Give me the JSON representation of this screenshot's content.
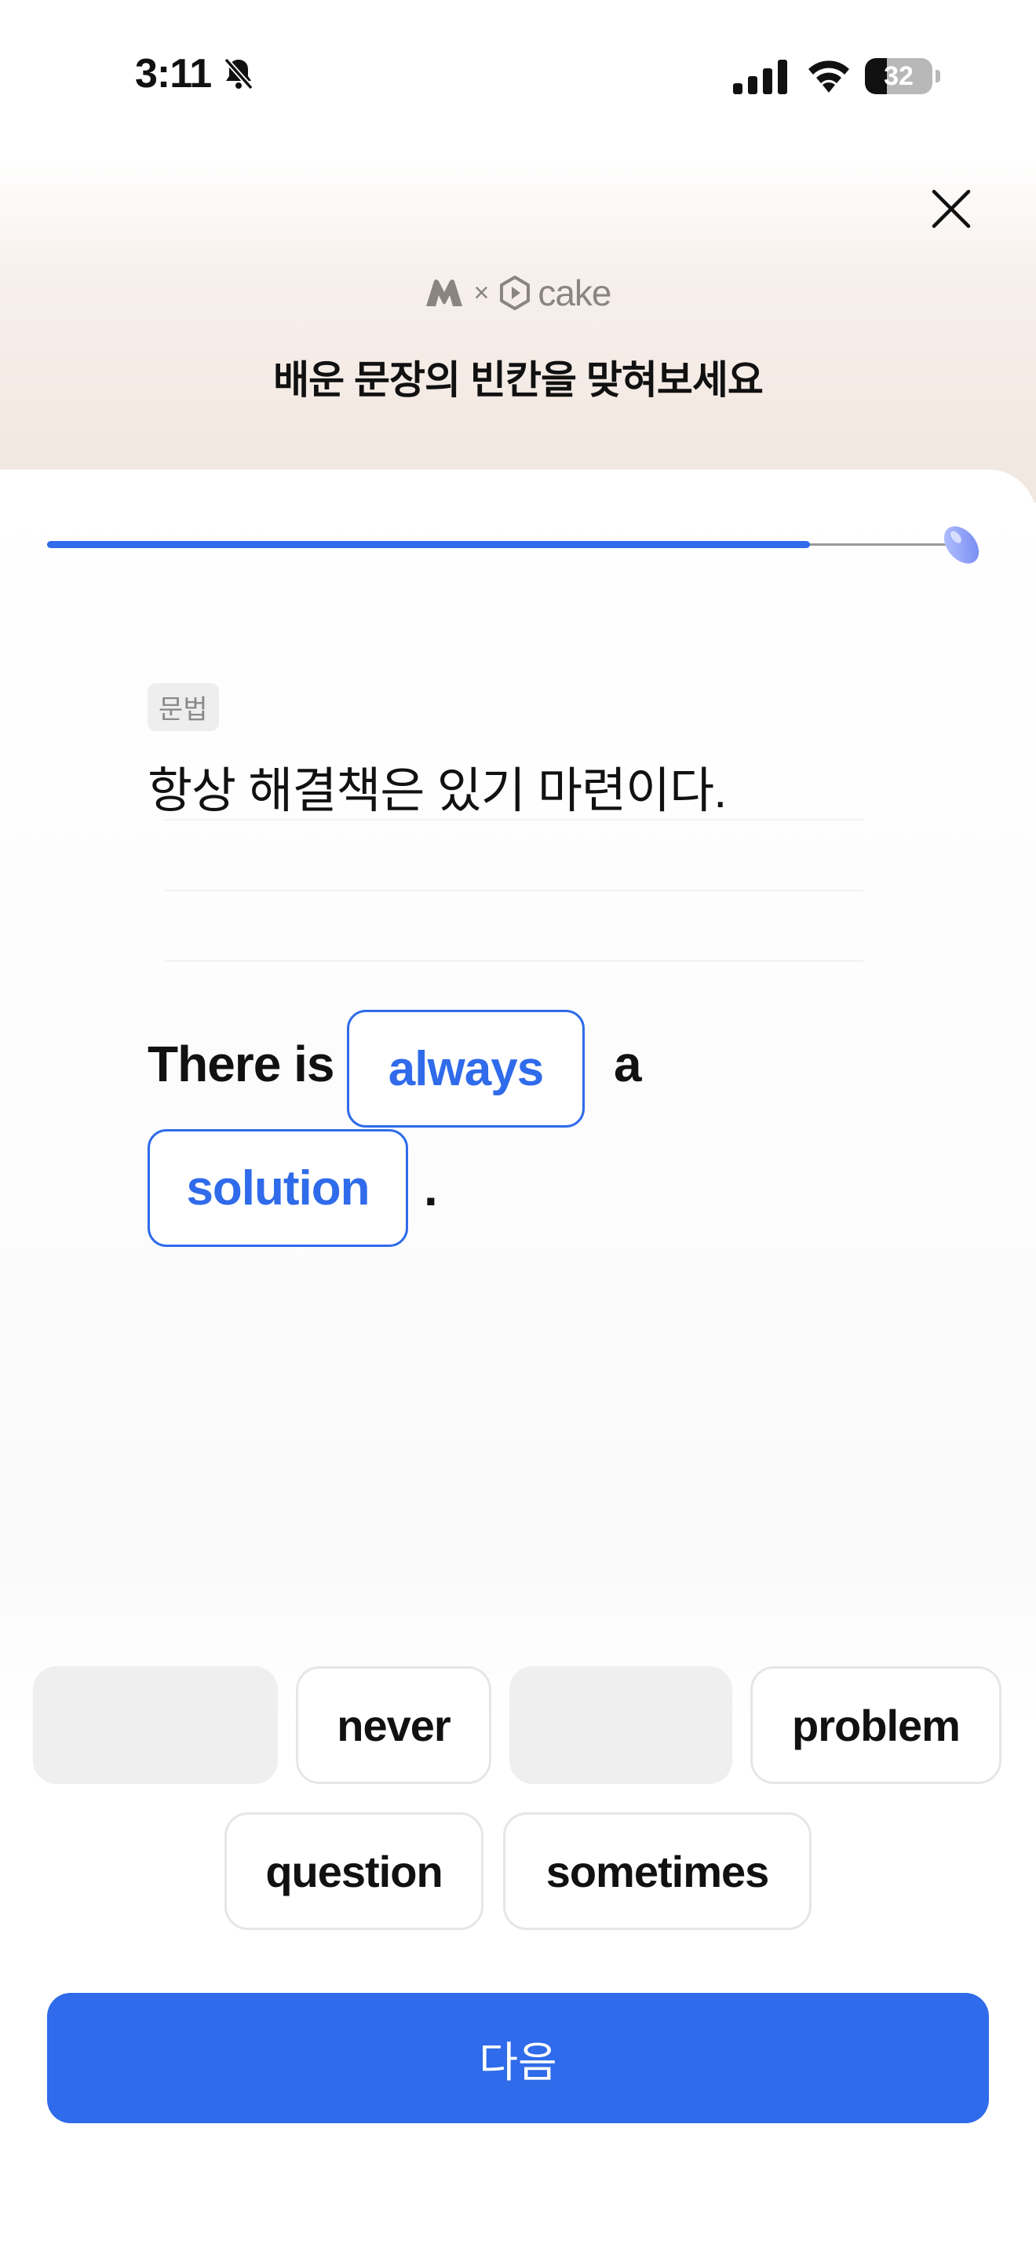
{
  "status_bar": {
    "time": "3:11",
    "battery_level": "32",
    "battery_fraction": 0.32,
    "icons": [
      "bell-slash-icon",
      "signal-icon",
      "wifi-icon",
      "battery-icon"
    ]
  },
  "header": {
    "brand_x": "×",
    "brand_name": "cake",
    "title": "배운 문장의 빈칸을 맞혀보세요",
    "close_icon": "close-icon"
  },
  "progress": {
    "fraction": 0.845,
    "end_icon": "bean-icon"
  },
  "colors": {
    "accent": "#2f6bea",
    "header_tint": "#f2e8e2",
    "used_tile": "#efefef"
  },
  "question": {
    "category": "문법",
    "korean": "항상 해결책은 있기 마련이다.",
    "sentence": {
      "part1": "There is",
      "blank1": "always",
      "part2": "a",
      "blank2": "solution",
      "part3": "."
    }
  },
  "word_bank": [
    {
      "label": "",
      "used": true
    },
    {
      "label": "never",
      "used": false
    },
    {
      "label": "",
      "used": true
    },
    {
      "label": "problem",
      "used": false
    },
    {
      "label": "question",
      "used": false
    },
    {
      "label": "sometimes",
      "used": false
    }
  ],
  "footer": {
    "next_label": "다음"
  }
}
